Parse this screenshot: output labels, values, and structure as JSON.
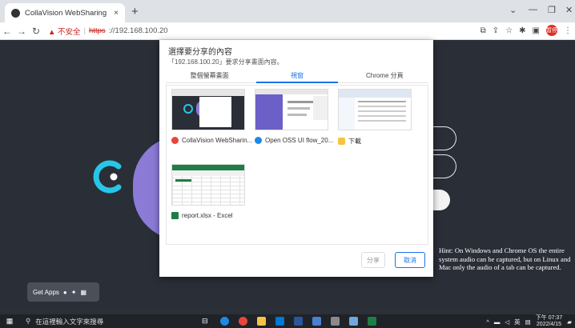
{
  "browser": {
    "tab_title": "CollaVision WebSharing",
    "tab_close": "×",
    "new_tab": "+",
    "url_warning": "▲ 不安全",
    "url_scheme": "https",
    "url_rest": "://192.168.100.20",
    "window_min": "—",
    "window_max": "❐",
    "window_close": "✕",
    "profile_label": "暂停"
  },
  "page": {
    "get_apps_label": "Get Apps",
    "hint_text": "Hint: On Windows and Chrome OS the entire system audio can be captured, but on Linux and Mac only the audio of a tab can be captured.",
    "accent_purple": "#8b7bd6"
  },
  "dialog": {
    "title": "選擇要分享的內容",
    "subtitle": "「192.168.100.20」要求分享畫面內容。",
    "tabs": [
      {
        "label": "整個螢幕畫面",
        "active": false
      },
      {
        "label": "視窗",
        "active": true
      },
      {
        "label": "Chrome 分頁",
        "active": false
      }
    ],
    "windows": [
      {
        "label": "CollaVision WebSharin...",
        "icon": "chrome-icon",
        "icon_color": "#e8453c"
      },
      {
        "label": "Open OSS UI flow_20...",
        "icon": "edge-icon",
        "icon_color": "#1e88e5"
      },
      {
        "label": "下載",
        "icon": "folder-icon",
        "icon_color": "#f6c343"
      },
      {
        "label": "report.xlsx - Excel",
        "icon": "excel-icon",
        "icon_color": "#1e7e45"
      }
    ],
    "share_label": "分享",
    "cancel_label": "取消"
  },
  "taskbar": {
    "search_placeholder": "在這裡輸入文字來搜尋",
    "tray_lang": "英",
    "time": "下午 07:37",
    "date": "2022/4/15"
  }
}
